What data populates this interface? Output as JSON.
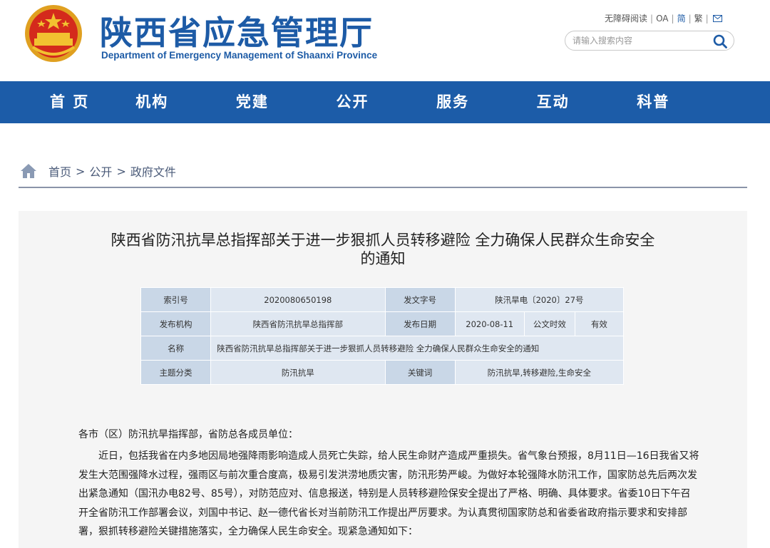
{
  "header": {
    "title": "陕西省应急管理厅",
    "subtitle": "Department of Emergency Management of Shaanxi Province",
    "top_links": [
      "无障碍阅读",
      "OA",
      "简",
      "繁"
    ],
    "search_placeholder": "请输入搜索内容",
    "accent_color": "#1d5ba6"
  },
  "nav": {
    "items": [
      "首 页",
      "机构",
      "党建",
      "公开",
      "服务",
      "互动",
      "科普"
    ],
    "background": "#1c5ca8"
  },
  "breadcrumb": {
    "items": [
      "首页",
      "公开",
      "政府文件"
    ],
    "separator": ">"
  },
  "document": {
    "title_line1": "陕西省防汛抗旱总指挥部关于进一步狠抓人员转移避险 全力确保人民群众生命安全",
    "title_line2": "的通知",
    "meta": {
      "index_label": "索引号",
      "index_value": "2020080650198",
      "doc_no_label": "发文字号",
      "doc_no_value": "陕汛旱电〔2020〕27号",
      "issuer_label": "发布机构",
      "issuer_value": "陕西省防汛抗旱总指挥部",
      "date_label": "发布日期",
      "date_value": "2020-08-11",
      "validity_label": "公文时效",
      "validity_value": "有效",
      "name_label": "名称",
      "name_value": "陕西省防汛抗旱总指挥部关于进一步狠抓人员转移避险 全力确保人民群众生命安全的通知",
      "topic_label": "主题分类",
      "topic_value": "防汛抗旱",
      "keywords_label": "关键词",
      "keywords_value": "防汛抗旱,转移避险,生命安全"
    },
    "salutation": "各市（区）防汛抗旱指挥部，省防总各成员单位：",
    "paragraph_lines": [
      "近日，包括我省在内多地因局地强降雨影响造成人员死亡失踪，给人民生命财产造成严重损失。省气象台预报，8月11日—16日我省又将",
      "发生大范围强降水过程，强雨区与前次重合度高，极易引发洪涝地质灾害，防汛形势严峻。为做好本轮强降水防汛工作，国家防总先后两次发",
      "出紧急通知（国汛办电82号、85号），对防范应对、信息报送，特别是人员转移避险保安全提出了严格、明确、具体要求。省委10日下午召",
      "开全省防汛工作部署会议，刘国中书记、赵一德代省长对当前防汛工作提出严厉要求。为认真贯彻国家防总和省委省政府指示要求和安排部",
      "署，狠抓转移避险关键措施落实，全力确保人民生命安全。现紧急通知如下："
    ]
  }
}
